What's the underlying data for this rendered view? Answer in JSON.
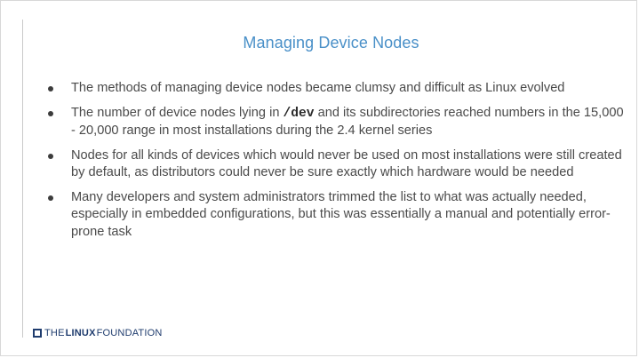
{
  "slide": {
    "title": "Managing Device Nodes",
    "bullets": [
      {
        "text": "The methods of managing device nodes became clumsy and difficult as Linux evolved"
      },
      {
        "text_before": "The number of device nodes lying in ",
        "code": "/dev",
        "text_after": " and its subdirectories reached numbers in the 15,000 - 20,000 range in most installations during the 2.4 kernel series"
      },
      {
        "text": "Nodes for all kinds of devices which would never be used on most installations were still created by default, as distributors could never be sure exactly which hardware would be needed"
      },
      {
        "text": "Many developers and system administrators trimmed the list to what was actually needed, especially in embedded configurations, but this was essentially a manual and potentially error-prone task"
      }
    ]
  },
  "footer": {
    "logo": {
      "the": "THE",
      "linux": "LINUX",
      "foundation": "FOUNDATION",
      "color": "#1f3c6e"
    }
  },
  "colors": {
    "title": "#4a90c8",
    "body_text": "#4a4a4a"
  }
}
